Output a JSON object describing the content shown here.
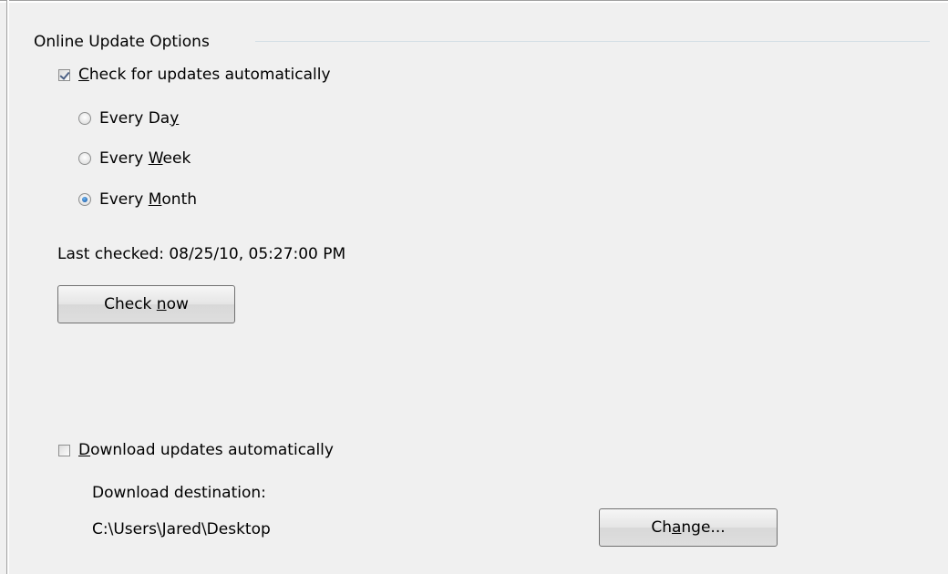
{
  "group": {
    "title": "Online Update Options"
  },
  "check_updates": {
    "checked": true,
    "label_mnemonic": "C",
    "label_rest": "heck for updates automatically"
  },
  "frequency": {
    "day": {
      "pre": "Every Da",
      "mnemonic": "y",
      "post": "",
      "selected": false
    },
    "week": {
      "pre": "Every ",
      "mnemonic": "W",
      "post": "eek",
      "selected": false
    },
    "month": {
      "pre": "Every ",
      "mnemonic": "M",
      "post": "onth",
      "selected": true
    }
  },
  "last_checked": "Last checked: 08/25/10, 05:27:00 PM",
  "check_now_button": {
    "pre": "Check ",
    "mnemonic": "n",
    "post": "ow"
  },
  "download": {
    "checked": false,
    "label_mnemonic": "D",
    "label_rest": "ownload updates automatically",
    "destination_label": "Download destination:",
    "destination_path": "C:\\Users\\Jared\\Desktop"
  },
  "change_button": {
    "pre": "Ch",
    "mnemonic": "a",
    "post": "nge..."
  }
}
